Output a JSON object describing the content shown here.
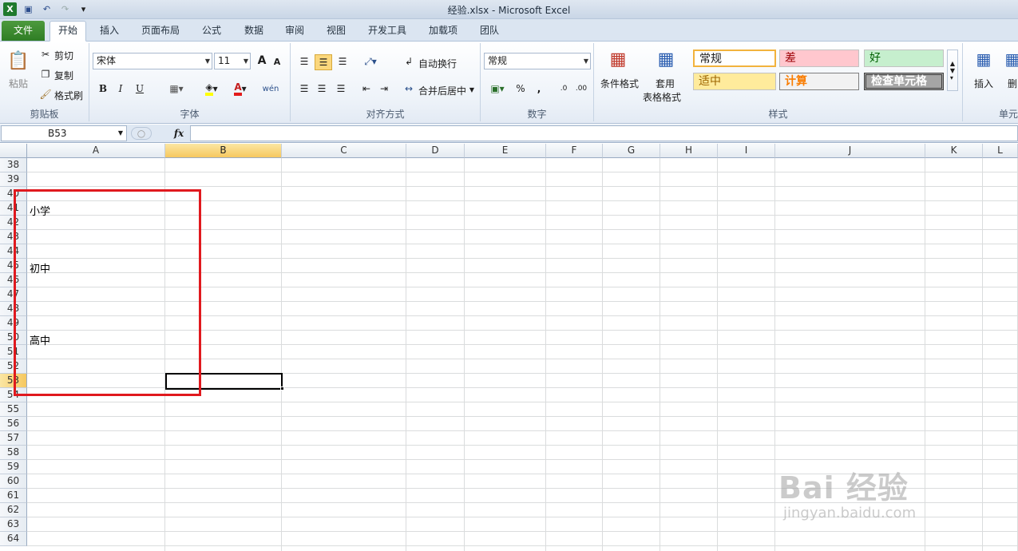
{
  "window": {
    "title": "经验.xlsx - Microsoft Excel"
  },
  "tabs": [
    "文件",
    "开始",
    "插入",
    "页面布局",
    "公式",
    "数据",
    "审阅",
    "视图",
    "开发工具",
    "加载项",
    "团队"
  ],
  "ribbon": {
    "clipboard": {
      "paste": "粘贴",
      "cut": "剪切",
      "copy": "复制",
      "format_painter": "格式刷",
      "label": "剪贴板"
    },
    "font": {
      "name": "宋体",
      "size": "11",
      "label": "字体",
      "bold": "B",
      "italic": "I",
      "underline": "U",
      "grow": "A",
      "shrink": "A"
    },
    "alignment": {
      "wrap": "自动换行",
      "merge": "合并后居中",
      "label": "对齐方式"
    },
    "number": {
      "format": "常规",
      "percent": "%",
      "comma": ",",
      "label": "数字"
    },
    "styles": {
      "conditional": "条件格式",
      "table_line1": "套用",
      "table_line2": "表格格式",
      "cells": [
        "常规",
        "差",
        "好",
        "适中",
        "计算",
        "检查单元格"
      ],
      "label": "样式"
    },
    "cells_group": {
      "insert": "插入",
      "delete": "删",
      "label": "单元"
    }
  },
  "formula_bar": {
    "name_box": "B53",
    "fx": "fx",
    "content": ""
  },
  "columns": [
    "A",
    "B",
    "C",
    "D",
    "E",
    "F",
    "G",
    "H",
    "I",
    "J",
    "K",
    "L"
  ],
  "rows": [
    "38",
    "39",
    "40",
    "41",
    "42",
    "43",
    "44",
    "45",
    "46",
    "47",
    "48",
    "49",
    "50",
    "51",
    "52",
    "53",
    "54",
    "55",
    "56",
    "57",
    "58",
    "59",
    "60",
    "61",
    "62",
    "63",
    "64"
  ],
  "cells": {
    "A41": "小学",
    "A45": "初中",
    "A50": "高中"
  },
  "selected_cell": "B53",
  "watermark": {
    "brand": "Bai 经验",
    "url": "jingyan.baidu.com"
  },
  "colors": {
    "file_tab": "#3b8a2f",
    "selection_header": "#f6c85f",
    "annotation_box": "#e0191e"
  }
}
